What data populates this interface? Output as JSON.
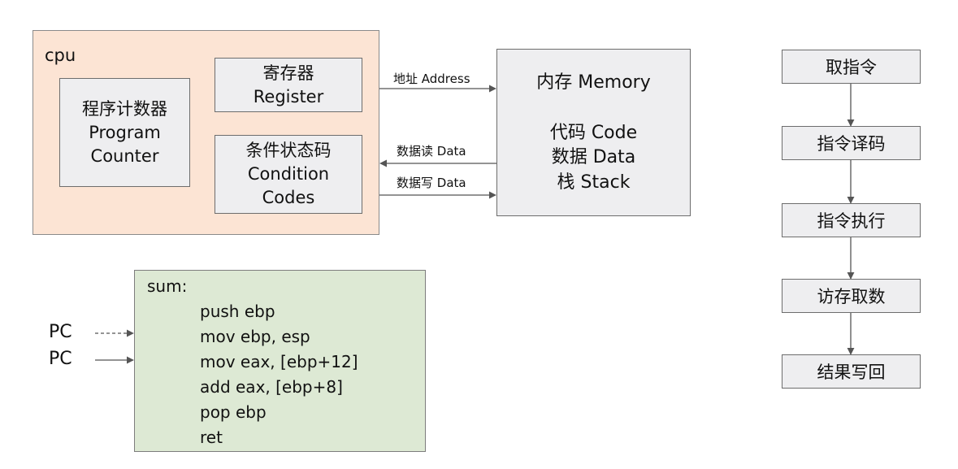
{
  "cpu": {
    "label": "cpu",
    "program_counter": {
      "zh": "程序计数器",
      "en1": "Program",
      "en2": "Counter"
    },
    "register": {
      "zh": "寄存器",
      "en": "Register"
    },
    "condition_codes": {
      "zh": "条件状态码",
      "en1": "Condition",
      "en2": "Codes"
    }
  },
  "memory": {
    "title": "内存 Memory",
    "items": [
      "代码 Code",
      "数据 Data",
      "栈 Stack"
    ]
  },
  "buses": {
    "address": "地址 Address",
    "data_read": "数据读 Data",
    "data_write": "数据写 Data"
  },
  "code": {
    "label": "sum:",
    "lines": [
      "push ebp",
      "mov ebp, esp",
      "mov eax, [ebp+12]",
      "add eax, [ebp+8]",
      "pop ebp",
      "ret"
    ]
  },
  "pc_pointers": [
    "PC",
    "PC"
  ],
  "pipeline": [
    "取指令",
    "指令译码",
    "指令执行",
    "访存取数",
    "结果写回"
  ],
  "colors": {
    "cpu_fill": "#fce4d4",
    "register_fill": "#eeeef0",
    "code_fill": "#dde9d4",
    "line": "#555555"
  }
}
